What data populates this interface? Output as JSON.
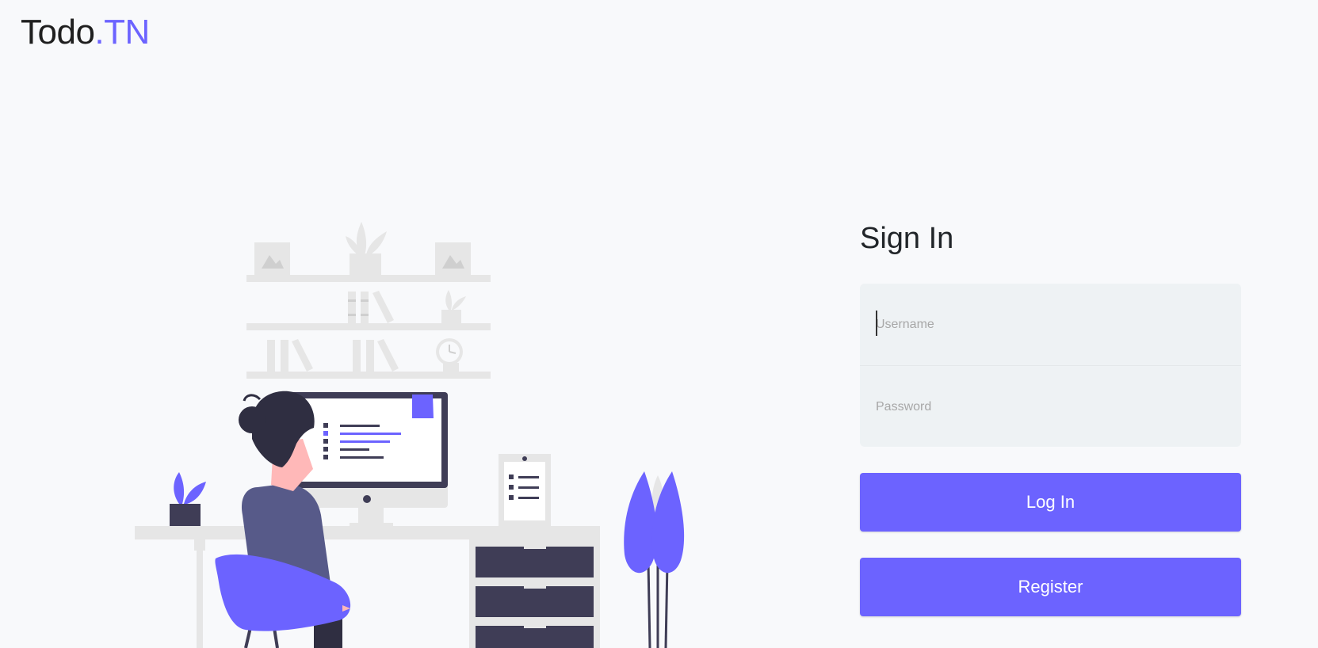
{
  "brand": {
    "name": "Todo",
    "suffix": ".TN"
  },
  "form": {
    "title": "Sign In",
    "username_placeholder": "Username",
    "password_placeholder": "Password",
    "login_label": "Log In",
    "register_label": "Register"
  },
  "colors": {
    "accent": "#6c63ff",
    "background": "#f8f9fb",
    "input_bg": "#eef2f4",
    "dark": "#3f3d56"
  },
  "illustration": {
    "icon": "woman-at-desk-illustration"
  }
}
